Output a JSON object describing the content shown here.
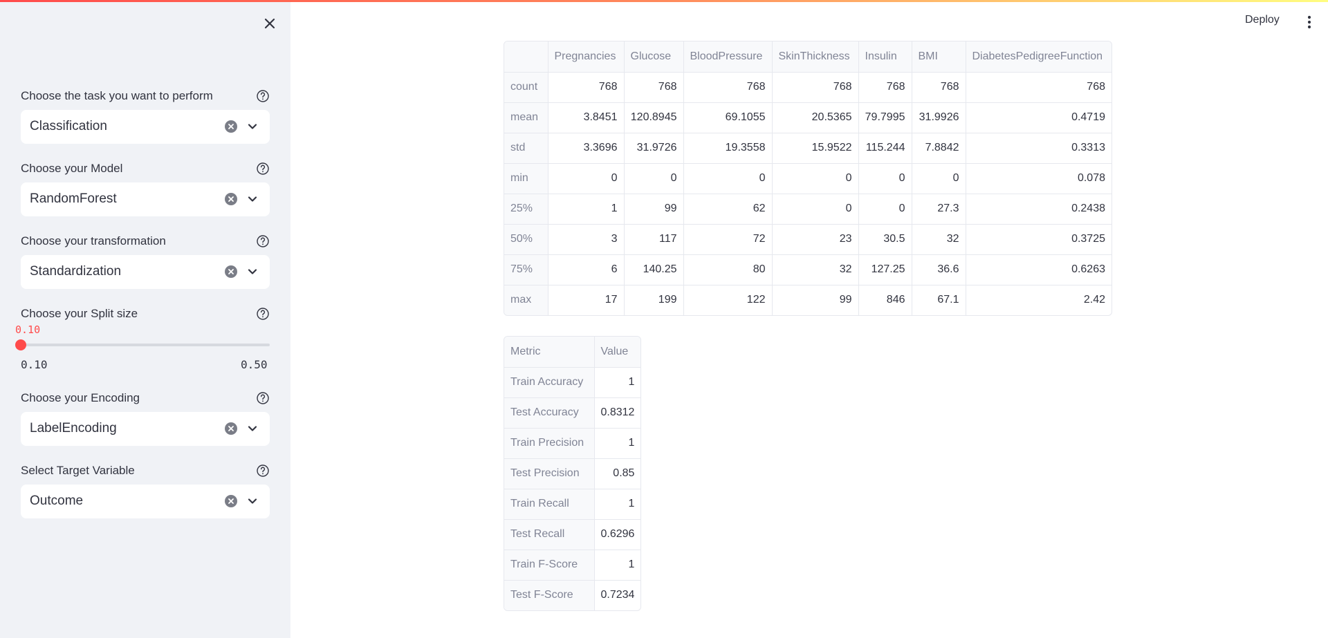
{
  "colors": {
    "accent": "#ff4b4b",
    "sidebar_bg": "#f0f2f6",
    "icon_grey": "#7a7d87"
  },
  "header": {
    "deploy_label": "Deploy",
    "menu_icon": "vertical-ellipsis-icon"
  },
  "sidebar": {
    "close_icon": "close-icon",
    "task": {
      "label": "Choose the task you want to perform",
      "value": "Classification"
    },
    "model": {
      "label": "Choose your Model",
      "value": "RandomForest"
    },
    "transformation": {
      "label": "Choose your transformation",
      "value": "Standardization"
    },
    "split": {
      "label": "Choose your Split size",
      "value": "0.10",
      "min": "0.10",
      "max": "0.50",
      "fraction": 0
    },
    "encoding": {
      "label": "Choose your Encoding",
      "value": "LabelEncoding"
    },
    "target": {
      "label": "Select Target Variable",
      "value": "Outcome"
    }
  },
  "stats_table": {
    "columns": [
      "",
      "Pregnancies",
      "Glucose",
      "BloodPressure",
      "SkinThickness",
      "Insulin",
      "BMI",
      "DiabetesPedigreeFunction"
    ],
    "rows": [
      [
        "count",
        "768",
        "768",
        "768",
        "768",
        "768",
        "768",
        "768"
      ],
      [
        "mean",
        "3.8451",
        "120.8945",
        "69.1055",
        "20.5365",
        "79.7995",
        "31.9926",
        "0.4719"
      ],
      [
        "std",
        "3.3696",
        "31.9726",
        "19.3558",
        "15.9522",
        "115.244",
        "7.8842",
        "0.3313"
      ],
      [
        "min",
        "0",
        "0",
        "0",
        "0",
        "0",
        "0",
        "0.078"
      ],
      [
        "25%",
        "1",
        "99",
        "62",
        "0",
        "0",
        "27.3",
        "0.2438"
      ],
      [
        "50%",
        "3",
        "117",
        "72",
        "23",
        "30.5",
        "32",
        "0.3725"
      ],
      [
        "75%",
        "6",
        "140.25",
        "80",
        "32",
        "127.25",
        "36.6",
        "0.6263"
      ],
      [
        "max",
        "17",
        "199",
        "122",
        "99",
        "846",
        "67.1",
        "2.42"
      ]
    ]
  },
  "metrics_table": {
    "columns": [
      "Metric",
      "Value"
    ],
    "rows": [
      [
        "Train Accuracy",
        "1"
      ],
      [
        "Test Accuracy",
        "0.8312"
      ],
      [
        "Train Precision",
        "1"
      ],
      [
        "Test Precision",
        "0.85"
      ],
      [
        "Train Recall",
        "1"
      ],
      [
        "Test Recall",
        "0.6296"
      ],
      [
        "Train F-Score",
        "1"
      ],
      [
        "Test F-Score",
        "0.7234"
      ]
    ]
  }
}
